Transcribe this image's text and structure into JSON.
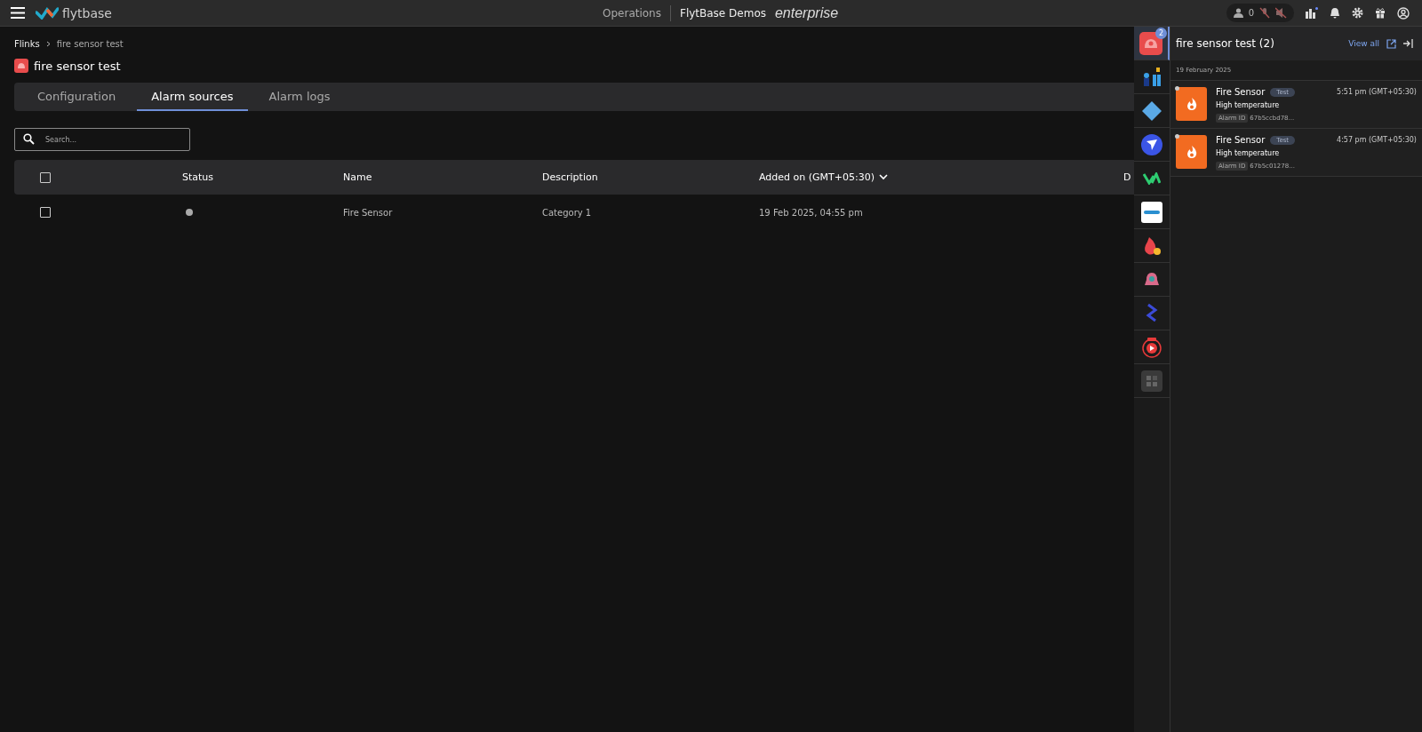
{
  "topbar": {
    "brand": "flytbase",
    "nav": "Operations",
    "org": "FlytBase Demos",
    "edition": "enterprise",
    "people_count": "0"
  },
  "breadcrumb": [
    "Flinks",
    "fire sensor test"
  ],
  "page_title": "fire sensor test",
  "tabs": [
    {
      "label": "Configuration",
      "selected": false
    },
    {
      "label": "Alarm sources",
      "selected": true
    },
    {
      "label": "Alarm logs",
      "selected": false
    }
  ],
  "search": {
    "placeholder": "Search..."
  },
  "table": {
    "select_all": false,
    "columns": [
      "Status",
      "Name",
      "Description",
      "Added on (GMT+05:30)",
      "D"
    ],
    "rows": [
      {
        "checked": false,
        "status_on": false,
        "name": "Fire Sensor",
        "description": "Category 1",
        "added_on": "19 Feb 2025, 04:55 pm"
      }
    ]
  },
  "rail": [
    {
      "kind": "fire-alarm",
      "selected": true,
      "badge": "2"
    },
    {
      "kind": "people"
    },
    {
      "kind": "diamond"
    },
    {
      "kind": "send"
    },
    {
      "kind": "va"
    },
    {
      "kind": "genetec"
    },
    {
      "kind": "flame"
    },
    {
      "kind": "bell"
    },
    {
      "kind": "chain"
    },
    {
      "kind": "live"
    },
    {
      "kind": "apps"
    }
  ],
  "panel": {
    "title": "fire sensor test (2)",
    "view_all": "View all",
    "date": "19 February 2025",
    "alarms": [
      {
        "source": "Fire Sensor",
        "tag": "Test",
        "time": "5:51 pm (GMT+05:30)",
        "message": "High temperature",
        "id_label": "Alarm ID",
        "id": "67b5ccbd78..."
      },
      {
        "source": "Fire Sensor",
        "tag": "Test",
        "time": "4:57 pm (GMT+05:30)",
        "message": "High temperature",
        "id_label": "Alarm ID",
        "id": "67b5c01278..."
      }
    ]
  }
}
